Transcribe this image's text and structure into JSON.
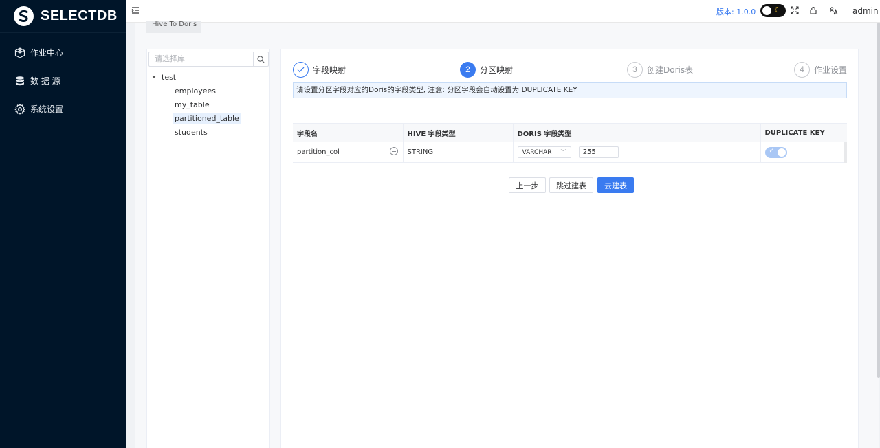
{
  "brand": {
    "name": "SELECTDB"
  },
  "sidebar": {
    "items": [
      {
        "label": "作业中心",
        "icon": "box-cube-icon"
      },
      {
        "label": "数 据 源",
        "icon": "database-icon"
      },
      {
        "label": "系统设置",
        "icon": "gear-icon"
      }
    ]
  },
  "header": {
    "version": "版本: 1.0.0",
    "user": "admin"
  },
  "tab": {
    "label": "Hive To Doris"
  },
  "tree": {
    "search_placeholder": "请选择库",
    "root": "test",
    "children": [
      "employees",
      "my_table",
      "partitioned_table",
      "students"
    ],
    "selected": "partitioned_table"
  },
  "steps": [
    {
      "num": "1",
      "title": "字段映射",
      "status": "done"
    },
    {
      "num": "2",
      "title": "分区映射",
      "status": "active"
    },
    {
      "num": "3",
      "title": "创建Doris表",
      "status": "wait"
    },
    {
      "num": "4",
      "title": "作业设置",
      "status": "wait"
    }
  ],
  "alert": {
    "text": "请设置分区字段对应的Doris的字段类型, 注意: 分区字段会自动设置为 DUPLICATE KEY"
  },
  "table": {
    "headers": [
      "字段名",
      "HIVE 字段类型",
      "DORIS 字段类型",
      "DUPLICATE KEY"
    ],
    "rows": [
      {
        "field": "partition_col",
        "hive_type": "STRING",
        "doris_type": "VARCHAR",
        "length": "255",
        "duplicate_key": true
      }
    ]
  },
  "buttons": {
    "prev": "上一步",
    "skip": "跳过建表",
    "create": "去建表"
  },
  "colors": {
    "primary": "#3a7bf0",
    "sidebar": "#001529"
  }
}
